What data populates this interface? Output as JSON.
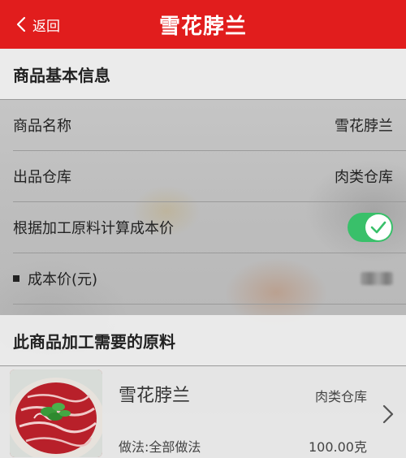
{
  "header": {
    "back_label": "返回",
    "title": "雪花脖兰"
  },
  "basic_info": {
    "section_title": "商品基本信息",
    "rows": [
      {
        "label": "商品名称",
        "value": "雪花脖兰"
      },
      {
        "label": "出品仓库",
        "value": "肉类仓库"
      }
    ],
    "calc_cost_label": "根据加工原料计算成本价",
    "calc_cost_enabled": true,
    "cost_price_label": "成本价(元)"
  },
  "materials": {
    "section_title": "此商品加工需要的原料",
    "items": [
      {
        "name": "雪花脖兰",
        "store": "肉类仓库",
        "method": "做法:全部做法",
        "quantity": "100.00克"
      }
    ]
  },
  "colors": {
    "header": "#e11d1d",
    "toggle_on": "#39c06a"
  },
  "icons": {
    "back": "chevron-left-icon",
    "toggle_check": "check-icon",
    "item_arrow": "chevron-right-icon"
  }
}
